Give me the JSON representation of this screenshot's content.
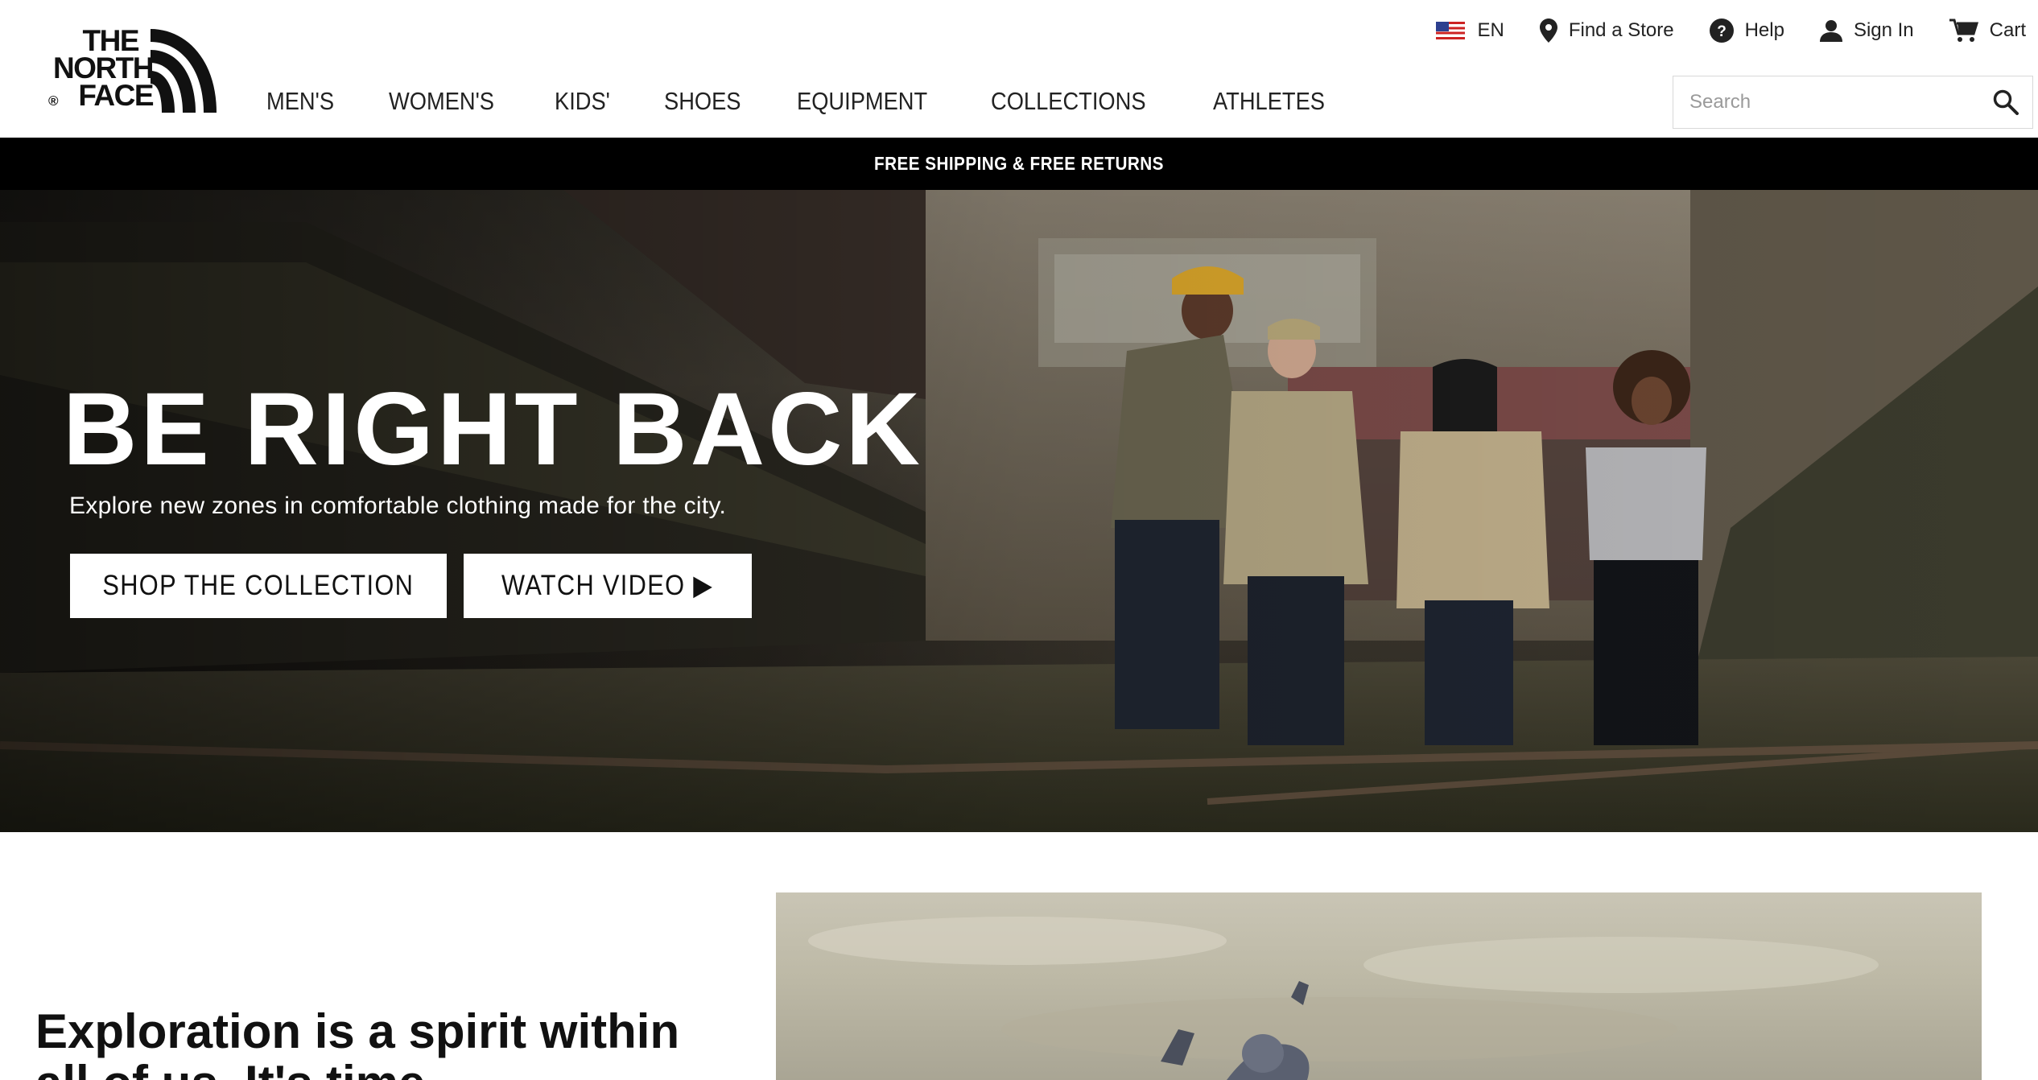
{
  "brand": {
    "logo_lines": [
      "THE",
      "NORTH",
      "FACE"
    ],
    "logo_registered": "®"
  },
  "utility": {
    "language": "EN",
    "find_store": "Find a Store",
    "help": "Help",
    "sign_in": "Sign In",
    "cart": "Cart"
  },
  "nav": {
    "items": [
      "MEN'S",
      "WOMEN'S",
      "KIDS'",
      "SHOES",
      "EQUIPMENT",
      "COLLECTIONS",
      "ATHLETES"
    ]
  },
  "search": {
    "placeholder": "Search",
    "value": ""
  },
  "promo": {
    "text": "FREE SHIPPING & FREE RETURNS"
  },
  "hero": {
    "title": "BE RIGHT BACK",
    "subtitle": "Explore new zones in comfortable clothing made for the city.",
    "shop_button": "SHOP THE COLLECTION",
    "watch_button": "WATCH VIDEO ▶"
  },
  "lower": {
    "heading": "Exploration is a spirit within all of us. It's time"
  },
  "colors": {
    "promo_bg": "#000000",
    "text": "#222222",
    "button_bg": "#ffffff"
  }
}
